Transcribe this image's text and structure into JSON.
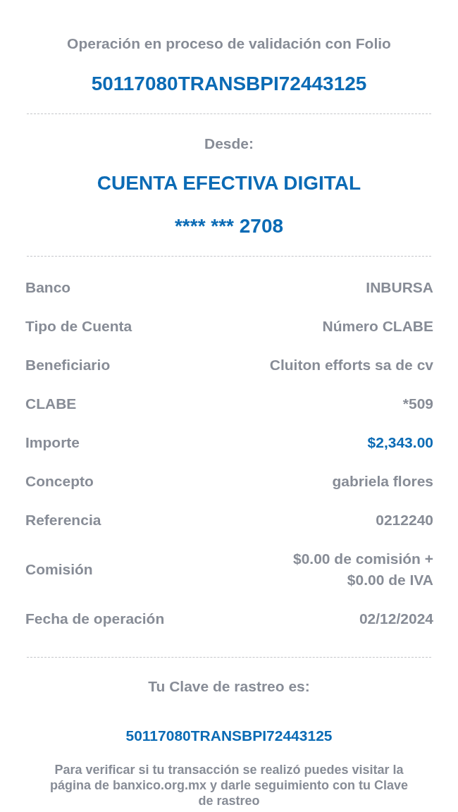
{
  "header": {
    "title": "Operación en proceso de validación con Folio",
    "folio": "50117080TRANSBPI72443125"
  },
  "origin": {
    "label": "Desde:",
    "account_name": "CUENTA EFECTIVA DIGITAL",
    "account_number": "**** *** 2708"
  },
  "details": [
    {
      "label": "Banco",
      "value": "INBURSA",
      "kind": "text"
    },
    {
      "label": "Tipo de Cuenta",
      "value": "Número CLABE",
      "kind": "text"
    },
    {
      "label": "Beneficiario",
      "value": "Cluiton efforts sa de cv",
      "kind": "text"
    },
    {
      "label": "CLABE",
      "value": "*509",
      "kind": "text"
    },
    {
      "label": "Importe",
      "value": "$2,343.00",
      "kind": "amount"
    },
    {
      "label": "Concepto",
      "value": "gabriela flores",
      "kind": "text"
    },
    {
      "label": "Referencia",
      "value": "0212240",
      "kind": "text"
    },
    {
      "label": "Comisión",
      "value": "$0.00 de comisión + $0.00 de IVA",
      "kind": "text"
    },
    {
      "label": "Fecha de operación",
      "value": "02/12/2024",
      "kind": "text"
    }
  ],
  "tracking": {
    "label": "Tu Clave de rastreo es:",
    "code": "50117080TRANSBPI72443125",
    "note": "Para verificar si tu transacción se realizó puedes visitar la página de banxico.org.mx y darle seguimiento con tu Clave de rastreo"
  }
}
